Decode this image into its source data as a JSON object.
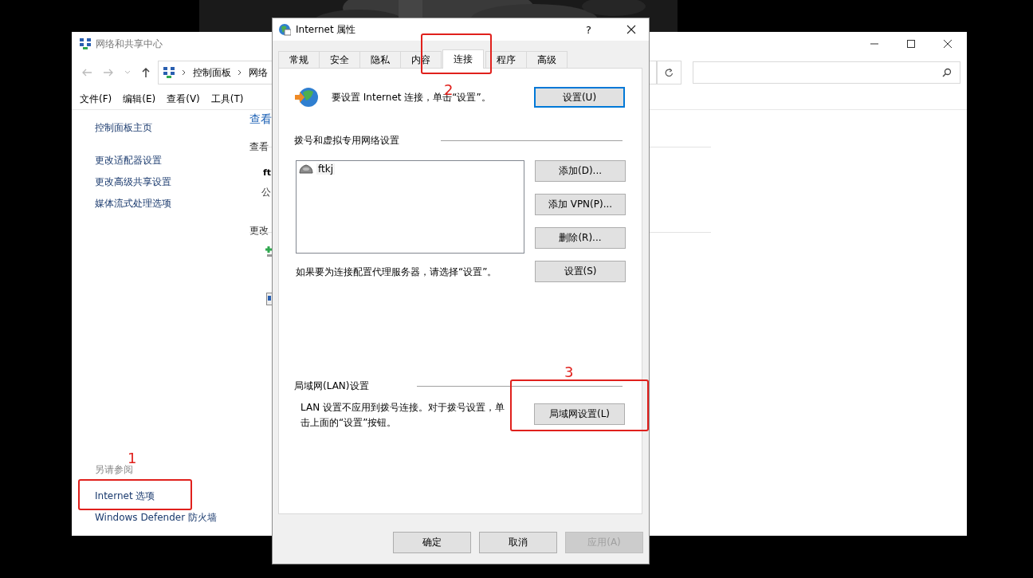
{
  "back_window": {
    "title": "网络和共享中心",
    "address": {
      "crumbs": [
        "控制面板",
        "网络"
      ]
    },
    "menu": [
      "文件(F)",
      "编辑(E)",
      "查看(V)",
      "工具(T)"
    ],
    "sidebar": {
      "items": [
        "控制面板主页",
        "更改适配器设置",
        "更改高级共享设置",
        "媒体流式处理选项"
      ]
    },
    "see_also": {
      "heading": "另请参阅",
      "items": [
        "Internet 选项",
        "Windows Defender 防火墙"
      ]
    },
    "main": {
      "heading": "查看",
      "subheading": "查看",
      "connection_name": "ft",
      "connection_type": "公",
      "change_heading": "更改"
    }
  },
  "dialog": {
    "title": "Internet 属性",
    "help": "?",
    "tabs": [
      {
        "label": "常规",
        "selected": false
      },
      {
        "label": "安全",
        "selected": false
      },
      {
        "label": "隐私",
        "selected": false
      },
      {
        "label": "内容",
        "selected": false
      },
      {
        "label": "连接",
        "selected": true
      },
      {
        "label": "程序",
        "selected": false
      },
      {
        "label": "高级",
        "selected": false
      }
    ],
    "setup": {
      "text": "要设置 Internet 连接，单击“设置”。",
      "button": {
        "label": "设置(U)",
        "focused": true
      }
    },
    "dialup": {
      "heading": "拨号和虚拟专用网络设置",
      "connections": [
        {
          "name": "ftkj"
        }
      ],
      "buttons": [
        "添加(D)...",
        "添加 VPN(P)...",
        "删除(R)...",
        "设置(S)"
      ],
      "proxy_text": "如果要为连接配置代理服务器，请选择“设置”。"
    },
    "lan": {
      "heading": "局域网(LAN)设置",
      "text": "LAN 设置不应用到拨号连接。对于拨号设置，单击上面的“设置”按钮。",
      "button": "局域网设置(L)"
    },
    "footer_buttons": [
      {
        "label": "确定",
        "disabled": false
      },
      {
        "label": "取消",
        "disabled": false
      },
      {
        "label": "应用(A)",
        "disabled": true
      }
    ]
  },
  "annotations": [
    {
      "label": "1"
    },
    {
      "label": "2"
    },
    {
      "label": "3"
    }
  ]
}
